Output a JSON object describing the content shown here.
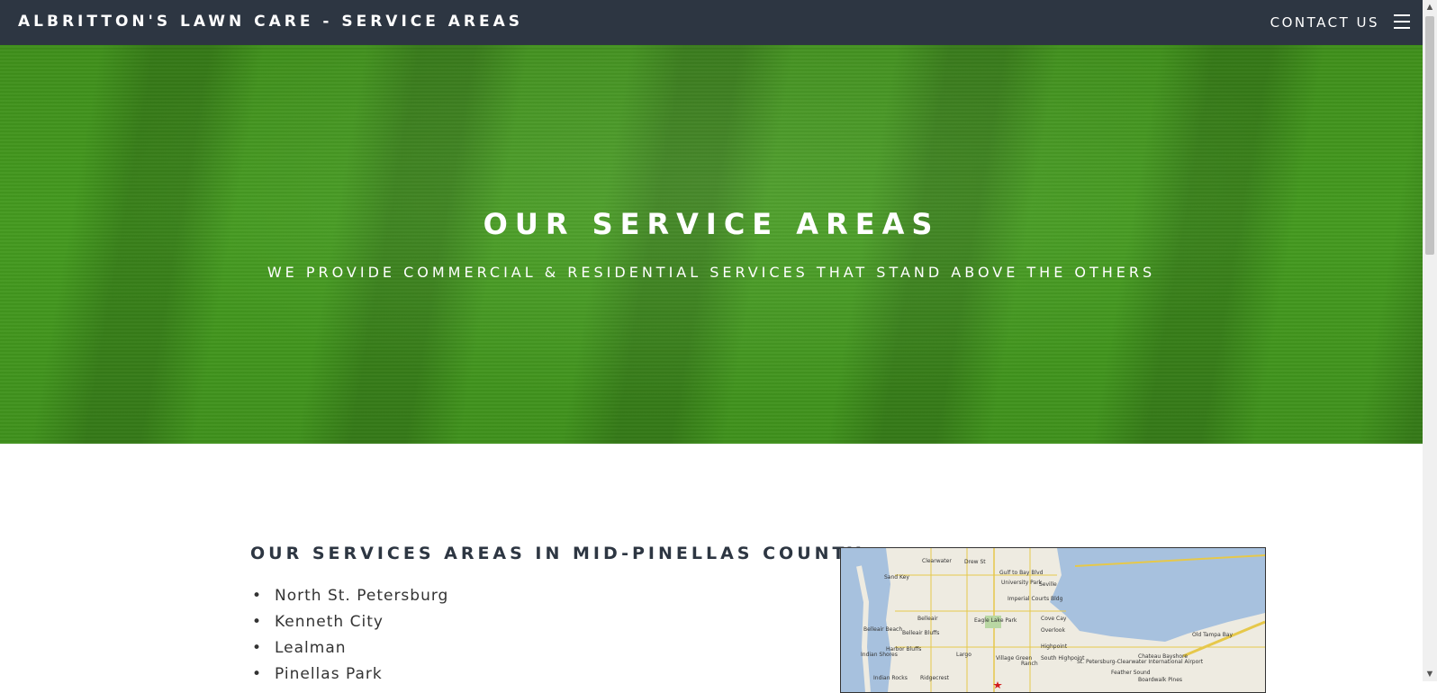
{
  "header": {
    "brand": "ALBRITTON'S LAWN CARE - SERVICE AREAS",
    "contact_label": "CONTACT US",
    "menu_icon": "hamburger-menu-icon"
  },
  "hero": {
    "title": "OUR SERVICE AREAS",
    "subtitle": "WE PROVIDE COMMERCIAL & RESIDENTIAL SERVICES THAT STAND ABOVE THE OTHERS"
  },
  "content": {
    "heading": "OUR SERVICES AREAS IN MID-PINELLAS COUNTY:",
    "areas": [
      "North St. Petersburg",
      "Kenneth City",
      "Lealman",
      "Pinellas Park"
    ]
  },
  "map": {
    "labels": [
      "Clearwater",
      "Drew St",
      "Sand Key",
      "Gulf to Bay Blvd",
      "University Park",
      "Seville",
      "Imperial Courts Bldg",
      "Belleair",
      "Eagle Lake Park",
      "Cove Cay",
      "Belleair Beach",
      "Belleair Bluffs",
      "Overlook",
      "Harbor Bluffs",
      "Largo",
      "Highpoint",
      "St. Petersburg-Clearwater International Airport",
      "Indian Rocks",
      "Ridgecrest",
      "Village Green",
      "South Highpoint",
      "Feather Sound",
      "Old Tampa Bay",
      "Indian Shores",
      "Ranch",
      "Chateau Bayshore",
      "Boardwalk Pines"
    ],
    "water_color": "#a7c1de",
    "land_color": "#eeebe1"
  },
  "colors": {
    "header_bg": "#2d3642",
    "grass": "#3f8f1b"
  }
}
